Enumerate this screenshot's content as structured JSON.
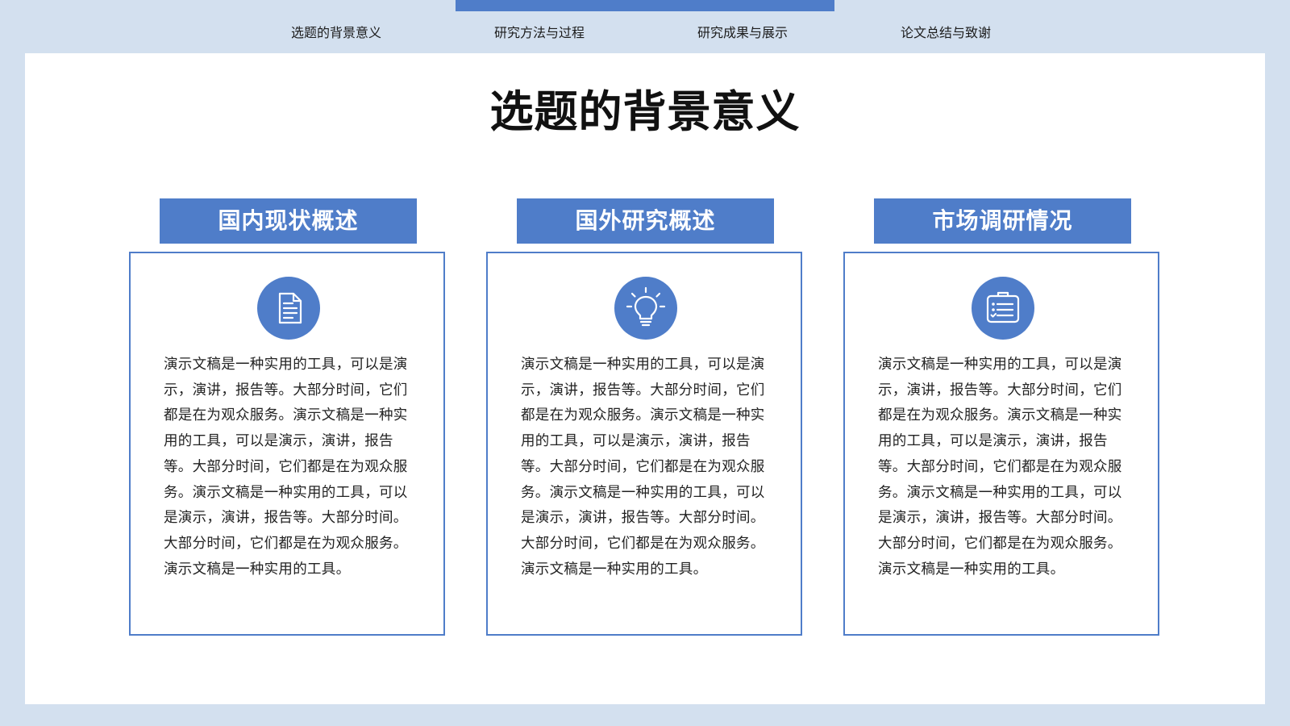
{
  "nav": {
    "items": [
      {
        "label": "选题的背景意义"
      },
      {
        "label": "研究方法与过程"
      },
      {
        "label": "研究成果与展示"
      },
      {
        "label": "论文总结与致谢"
      }
    ],
    "active_indicator_color": "#4f7dc9"
  },
  "page": {
    "title": "选题的背景意义"
  },
  "cards": [
    {
      "title": "国内现状概述",
      "icon": "document-icon",
      "text": "演示文稿是一种实用的工具，可以是演示，演讲，报告等。大部分时间，它们都是在为观众服务。演示文稿是一种实用的工具，可以是演示，演讲，报告等。大部分时间，它们都是在为观众服务。演示文稿是一种实用的工具，可以是演示，演讲，报告等。大部分时间。大部分时间，它们都是在为观众服务。演示文稿是一种实用的工具。"
    },
    {
      "title": "国外研究概述",
      "icon": "lightbulb-icon",
      "text": "演示文稿是一种实用的工具，可以是演示，演讲，报告等。大部分时间，它们都是在为观众服务。演示文稿是一种实用的工具，可以是演示，演讲，报告等。大部分时间，它们都是在为观众服务。演示文稿是一种实用的工具，可以是演示，演讲，报告等。大部分时间。大部分时间，它们都是在为观众服务。演示文稿是一种实用的工具。"
    },
    {
      "title": "市场调研情况",
      "icon": "checklist-icon",
      "text": "演示文稿是一种实用的工具，可以是演示，演讲，报告等。大部分时间，它们都是在为观众服务。演示文稿是一种实用的工具，可以是演示，演讲，报告等。大部分时间，它们都是在为观众服务。演示文稿是一种实用的工具，可以是演示，演讲，报告等。大部分时间。大部分时间，它们都是在为观众服务。演示文稿是一种实用的工具。"
    }
  ],
  "colors": {
    "accent": "#4f7dc9",
    "background": "#d3e0ef",
    "panel": "#ffffff"
  }
}
